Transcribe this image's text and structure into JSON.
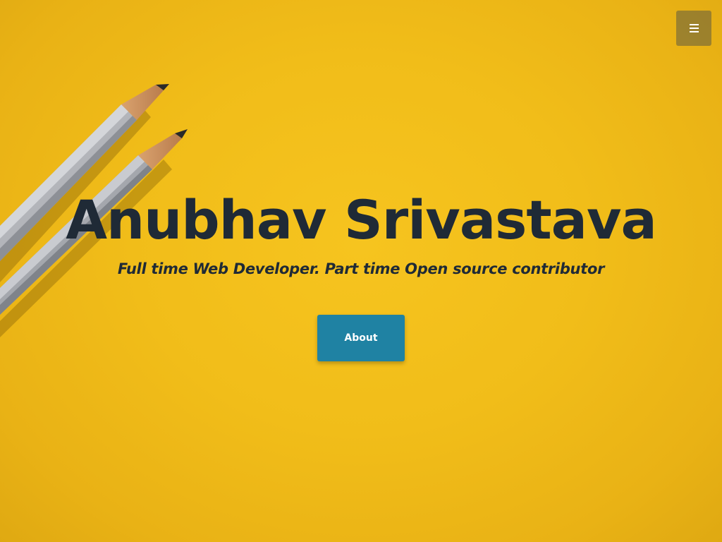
{
  "hero": {
    "title": "Anubhav Srivastava",
    "subtitle": "Full time Web Developer. Part time Open source contributor",
    "about_label": "About",
    "background_color": "#f1bd19",
    "text_color": "#1f2a36",
    "button_color": "#1f82a3",
    "decoration_image": "pencils"
  },
  "nav": {
    "menu_icon": "hamburger-icon",
    "menu_button_color": "#8f8247"
  }
}
